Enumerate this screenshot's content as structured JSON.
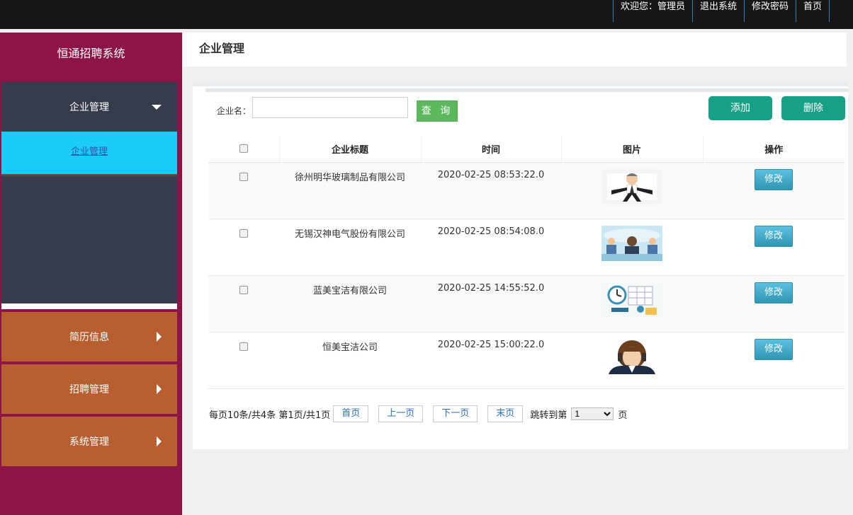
{
  "topnav": {
    "welcome": "欢迎您：管理员",
    "logout": "退出系统",
    "change_password": "修改密码",
    "home": "首页"
  },
  "sidebar": {
    "brand": "恒通招聘系统",
    "menus": [
      {
        "label": "企业管理",
        "expanded": true,
        "children": [
          {
            "label": "企业管理"
          }
        ]
      },
      {
        "label": "简历信息",
        "expanded": false
      },
      {
        "label": "招聘管理",
        "expanded": false
      },
      {
        "label": "系统管理",
        "expanded": false
      }
    ]
  },
  "page": {
    "title": "企业管理"
  },
  "search": {
    "label": "企业名：",
    "value": "",
    "query_button": "查 询"
  },
  "actions": {
    "add": "添加",
    "delete": "删除"
  },
  "table": {
    "headers": [
      "企业标题",
      "时间",
      "图片",
      "操作"
    ],
    "rows": [
      {
        "title": "徐州明华玻璃制品有限公司",
        "time": "2020-02-25 08:53:22.0",
        "image": "cartoon-businessman-thumb",
        "action": "修改"
      },
      {
        "title": "无锡汉神电气股份有限公司",
        "time": "2020-02-25 08:54:08.0",
        "image": "business-meeting-thumb",
        "action": "修改"
      },
      {
        "title": "蓝美宝洁有限公司",
        "time": "2020-02-25 14:55:52.0",
        "image": "schedule-clock-thumb",
        "action": "修改"
      },
      {
        "title": "恒美宝洁公司",
        "time": "2020-02-25 15:00:22.0",
        "image": "headset-agent-thumb",
        "action": "修改"
      }
    ]
  },
  "pager": {
    "summary": "每页10条/共4条 第1页/共1页",
    "first": "首页",
    "prev": "上一页",
    "next": "下一页",
    "last": "末页",
    "jump_prefix": "跳转到第",
    "jump_value": "1",
    "jump_suffix": "页"
  },
  "colors": {
    "topbar": "#161616",
    "sidebar": "#8d1446",
    "menu_active": "#363c4c",
    "submenu_active": "#1bcbf9",
    "menu_collapsed": "#b75f31",
    "teal_button": "#16a085",
    "query_button": "#5cb85c"
  }
}
